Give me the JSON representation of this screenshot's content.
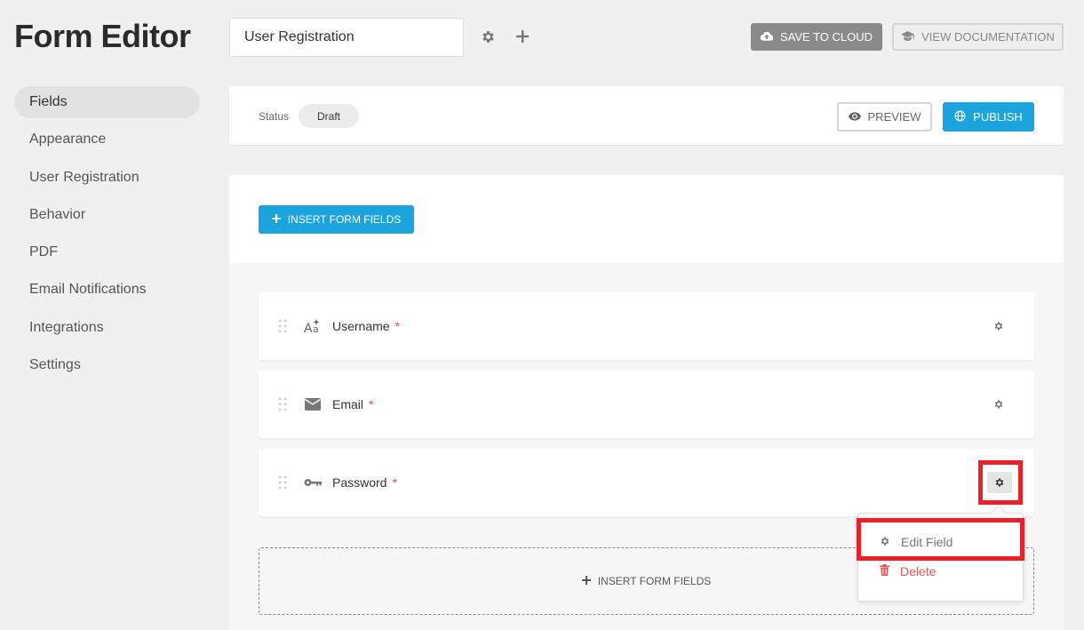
{
  "header": {
    "app_title": "Form Editor",
    "form_name": "User Registration",
    "save_label": "SAVE TO CLOUD",
    "docs_label": "VIEW DOCUMENTATION"
  },
  "sidebar": {
    "items": [
      {
        "label": "Fields",
        "active": true
      },
      {
        "label": "Appearance"
      },
      {
        "label": "User Registration"
      },
      {
        "label": "Behavior"
      },
      {
        "label": "PDF"
      },
      {
        "label": "Email Notifications"
      },
      {
        "label": "Integrations"
      },
      {
        "label": "Settings"
      }
    ]
  },
  "status_bar": {
    "label": "Status",
    "value": "Draft",
    "preview_label": "PREVIEW",
    "publish_label": "PUBLISH"
  },
  "main": {
    "insert_top_label": "INSERT FORM FIELDS",
    "fields": [
      {
        "label": "Username",
        "required": "*",
        "icon": "text-style-icon"
      },
      {
        "label": "Email",
        "required": "*",
        "icon": "envelope-icon"
      },
      {
        "label": "Password",
        "required": "*",
        "icon": "key-icon"
      }
    ],
    "insert_bottom_label": "INSERT FORM FIELDS"
  },
  "field_menu": {
    "edit_label": "Edit Field",
    "delete_label": "Delete"
  },
  "colors": {
    "accent": "#1ba4de",
    "highlight": "#ee1f2b",
    "danger": "#e05757"
  }
}
